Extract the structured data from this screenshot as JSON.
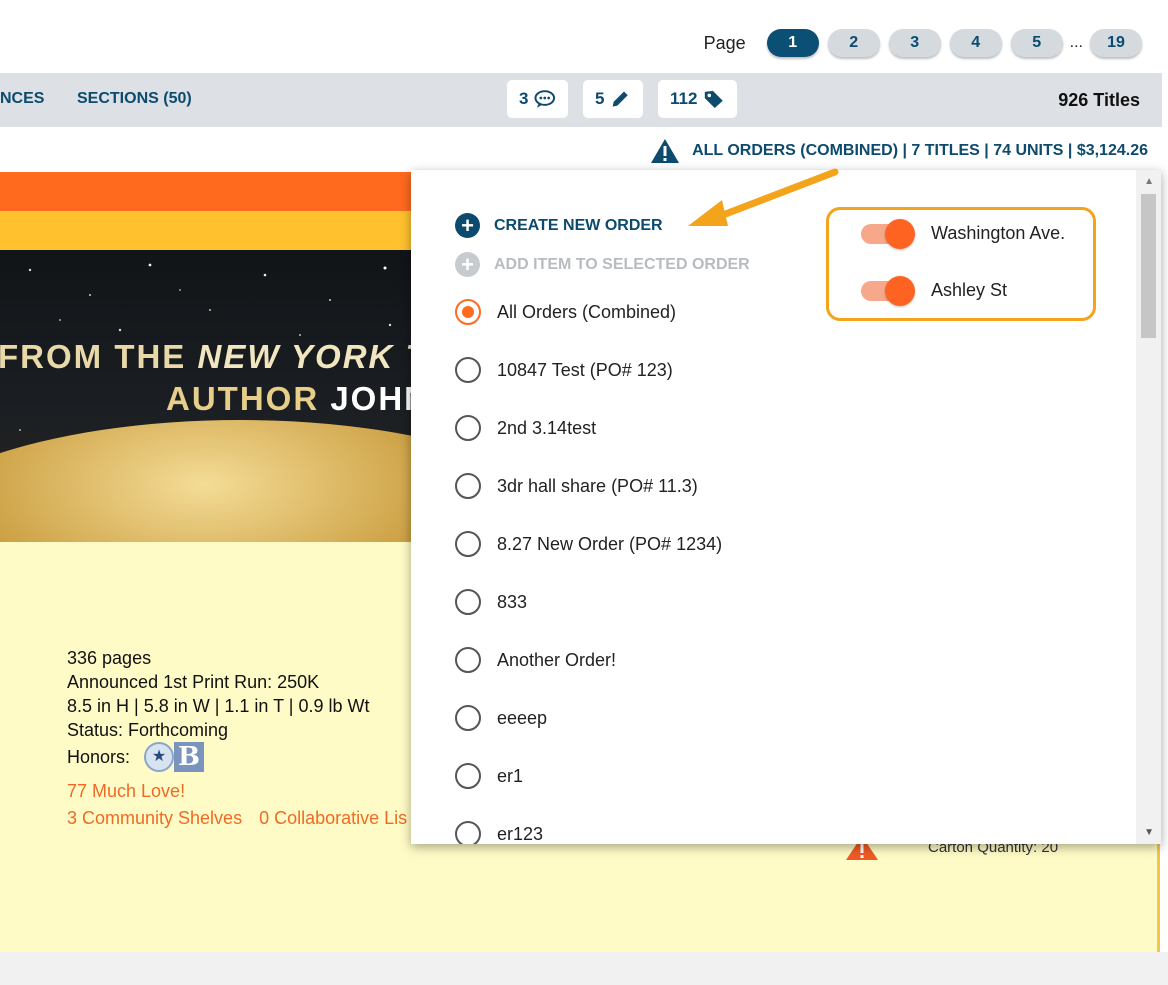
{
  "pagination": {
    "label": "Page",
    "pages": [
      "1",
      "2",
      "3",
      "4",
      "5"
    ],
    "current": "1",
    "ellipsis": "...",
    "last": "19"
  },
  "navbar": {
    "items": [
      {
        "label": "NCES"
      },
      {
        "label": "SECTIONS (50)"
      }
    ],
    "chips": [
      {
        "count": "3",
        "icon": "comment-icon"
      },
      {
        "count": "5",
        "icon": "pencil-icon"
      },
      {
        "count": "112",
        "icon": "tag-icon"
      }
    ],
    "titles_count": "926 Titles"
  },
  "order_summary": {
    "icon": "warning-icon",
    "text": "ALL ORDERS (COMBINED) | 7 TITLES | 74 UNITS | $3,124.26"
  },
  "book": {
    "banner_line1_a": "FROM THE ",
    "banner_line1_b": "NEW YORK TI",
    "banner_line2_a": "AUTHOR ",
    "banner_line2_b": "JOHN",
    "details": [
      "336 pages",
      "Announced 1st Print Run: 250K",
      "8.5 in H | 5.8 in W | 1.1 in T | 0.9 lb Wt",
      "Status: Forthcoming"
    ],
    "honors_label": "Honors:",
    "honor_badge_letter": "B",
    "love_link": "77 Much Love!",
    "shelves_link": "3 Community Shelves",
    "lists_link": "0 Collaborative Lis",
    "carton": "Carton Quantity: 20"
  },
  "dropdown": {
    "create_label": "CREATE NEW ORDER",
    "add_item_label": "ADD ITEM TO SELECTED ORDER",
    "orders": [
      {
        "label": "All Orders (Combined)",
        "selected": true
      },
      {
        "label": "10847 Test (PO# 123)",
        "selected": false
      },
      {
        "label": "2nd 3.14test",
        "selected": false
      },
      {
        "label": "3dr hall share (PO# 11.3)",
        "selected": false
      },
      {
        "label": "8.27 New Order (PO# 1234)",
        "selected": false
      },
      {
        "label": "833",
        "selected": false
      },
      {
        "label": "Another Order!",
        "selected": false
      },
      {
        "label": "eeeep",
        "selected": false
      },
      {
        "label": "er1",
        "selected": false
      },
      {
        "label": "er123",
        "selected": false
      }
    ],
    "stores": [
      {
        "label": "Washington Ave.",
        "on": true
      },
      {
        "label": "Ashley St",
        "on": true
      }
    ]
  },
  "colors": {
    "brand_navy": "#0c4a6e",
    "accent_orange": "#ff6a1f",
    "annotation_gold": "#f4a41a"
  }
}
